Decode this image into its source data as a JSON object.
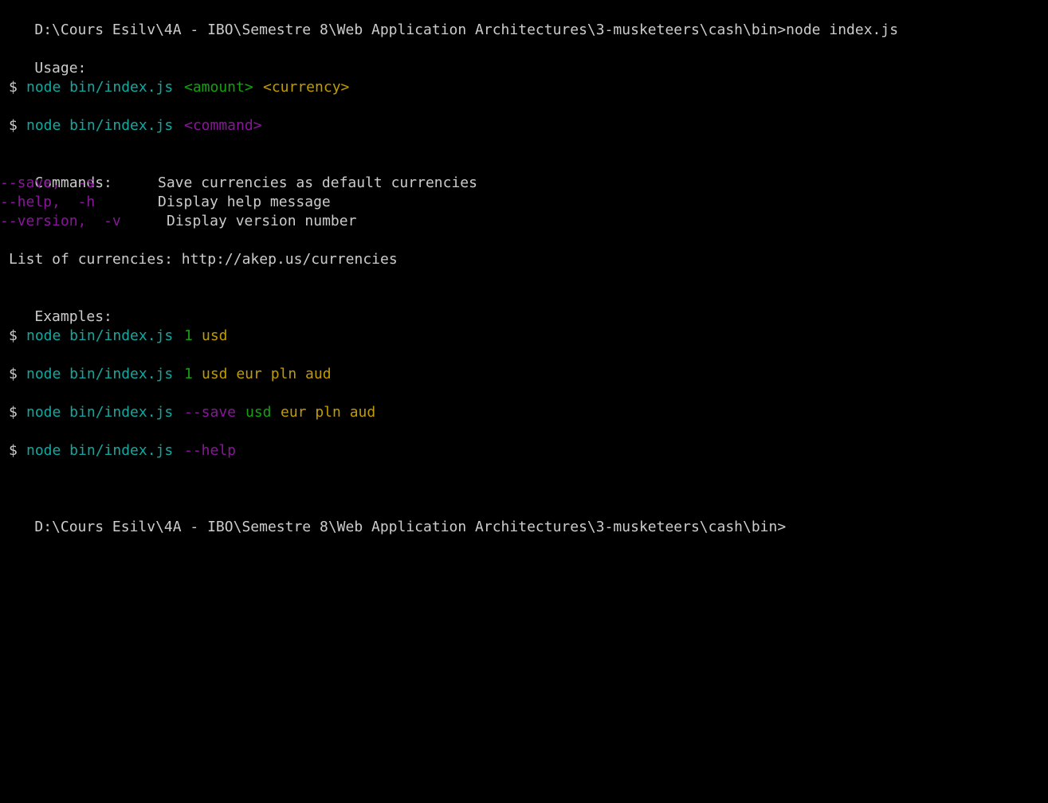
{
  "colors": {
    "background": "#000000",
    "default_text": "#cccccc",
    "command_teal": "#11a8a0",
    "arg_green": "#13a10e",
    "arg_yellow": "#c19c00",
    "flag_magenta": "#881798"
  },
  "prompt_top": "D:\\Cours Esilv\\4A - IBO\\Semestre 8\\Web Application Architectures\\3-musketeers\\cash\\bin>",
  "typed_command": "node index.js",
  "usage": {
    "heading": "Usage:",
    "line1": {
      "dollar": "$",
      "cmd": "node bin/index.js",
      "arg1": "<amount>",
      "arg2": "<currency>"
    },
    "line2": {
      "dollar": "$",
      "cmd": "node bin/index.js",
      "arg1": "<command>"
    }
  },
  "commands": {
    "heading": "Commands:",
    "items": [
      {
        "flags": "--save,  -s",
        "desc": "Save currencies as default currencies"
      },
      {
        "flags": "--help,  -h",
        "desc": "Display help message"
      },
      {
        "flags": "--version,  -v",
        "desc": "Display version number"
      }
    ]
  },
  "currency_list": "List of currencies: http://akep.us/currencies",
  "examples": {
    "heading": "Examples:",
    "ex1": {
      "dollar": "$",
      "cmd": "node bin/index.js",
      "amount": "1",
      "rest": "usd"
    },
    "ex2": {
      "dollar": "$",
      "cmd": "node bin/index.js",
      "amount": "1",
      "rest": "usd eur pln aud"
    },
    "ex3": {
      "dollar": "$",
      "cmd": "node bin/index.js",
      "flag": "--save",
      "first": "usd",
      "rest": "eur pln aud"
    },
    "ex4": {
      "dollar": "$",
      "cmd": "node bin/index.js",
      "flag": "--help"
    }
  },
  "prompt_bottom": "D:\\Cours Esilv\\4A - IBO\\Semestre 8\\Web Application Architectures\\3-musketeers\\cash\\bin>"
}
